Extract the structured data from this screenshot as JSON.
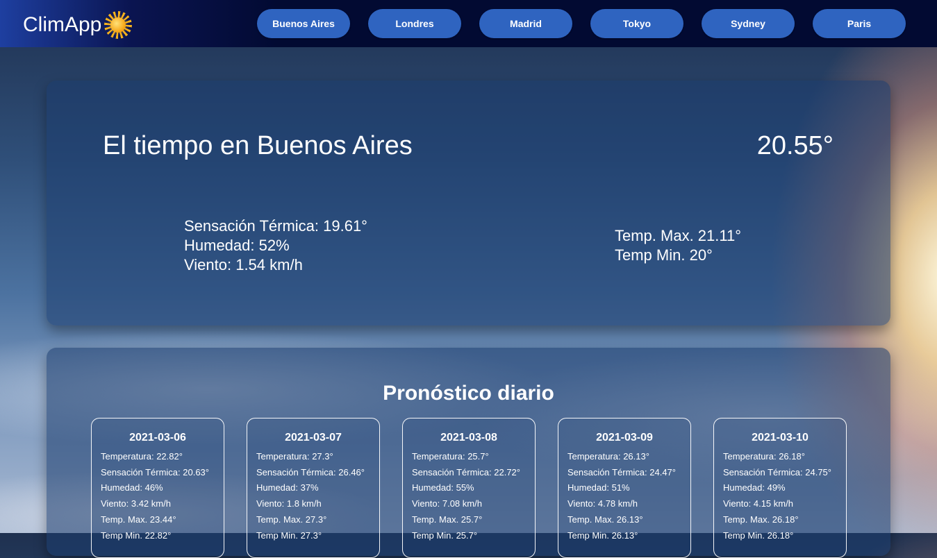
{
  "nav": {
    "brand": "ClimApp",
    "brand_icon": "sun-icon",
    "cities": [
      "Buenos Aires",
      "Londres",
      "Madrid",
      "Tokyo",
      "Sydney",
      "Paris"
    ]
  },
  "current": {
    "title": "El tiempo en Buenos Aires",
    "temp": "20.55°",
    "feels_like": "Sensación Térmica: 19.61°",
    "humidity": "Humedad: 52%",
    "wind": "Viento: 1.54 km/h",
    "temp_max": "Temp. Max. 21.11°",
    "temp_min": "Temp Min. 20°"
  },
  "forecast": {
    "title": "Pronóstico diario",
    "days": [
      {
        "date": "2021-03-06",
        "temperature": "Temperatura: 22.82°",
        "feels_like": "Sensación Térmica: 20.63°",
        "humidity": "Humedad: 46%",
        "wind": "Viento: 3.42 km/h",
        "temp_max": "Temp. Max. 23.44°",
        "temp_min": "Temp Min. 22.82°"
      },
      {
        "date": "2021-03-07",
        "temperature": "Temperatura: 27.3°",
        "feels_like": "Sensación Térmica: 26.46°",
        "humidity": "Humedad: 37%",
        "wind": "Viento: 1.8 km/h",
        "temp_max": "Temp. Max. 27.3°",
        "temp_min": "Temp Min. 27.3°"
      },
      {
        "date": "2021-03-08",
        "temperature": "Temperatura: 25.7°",
        "feels_like": "Sensación Térmica: 22.72°",
        "humidity": "Humedad: 55%",
        "wind": "Viento: 7.08 km/h",
        "temp_max": "Temp. Max. 25.7°",
        "temp_min": "Temp Min. 25.7°"
      },
      {
        "date": "2021-03-09",
        "temperature": "Temperatura: 26.13°",
        "feels_like": "Sensación Térmica: 24.47°",
        "humidity": "Humedad: 51%",
        "wind": "Viento: 4.78 km/h",
        "temp_max": "Temp. Max. 26.13°",
        "temp_min": "Temp Min. 26.13°"
      },
      {
        "date": "2021-03-10",
        "temperature": "Temperatura: 26.18°",
        "feels_like": "Sensación Térmica: 24.75°",
        "humidity": "Humedad: 49%",
        "wind": "Viento: 4.15 km/h",
        "temp_max": "Temp. Max. 26.18°",
        "temp_min": "Temp Min. 26.18°"
      }
    ]
  },
  "colors": {
    "nav_bg": "#020a32",
    "nav_button": "#2f64c0",
    "sun": "#f5a10f"
  }
}
